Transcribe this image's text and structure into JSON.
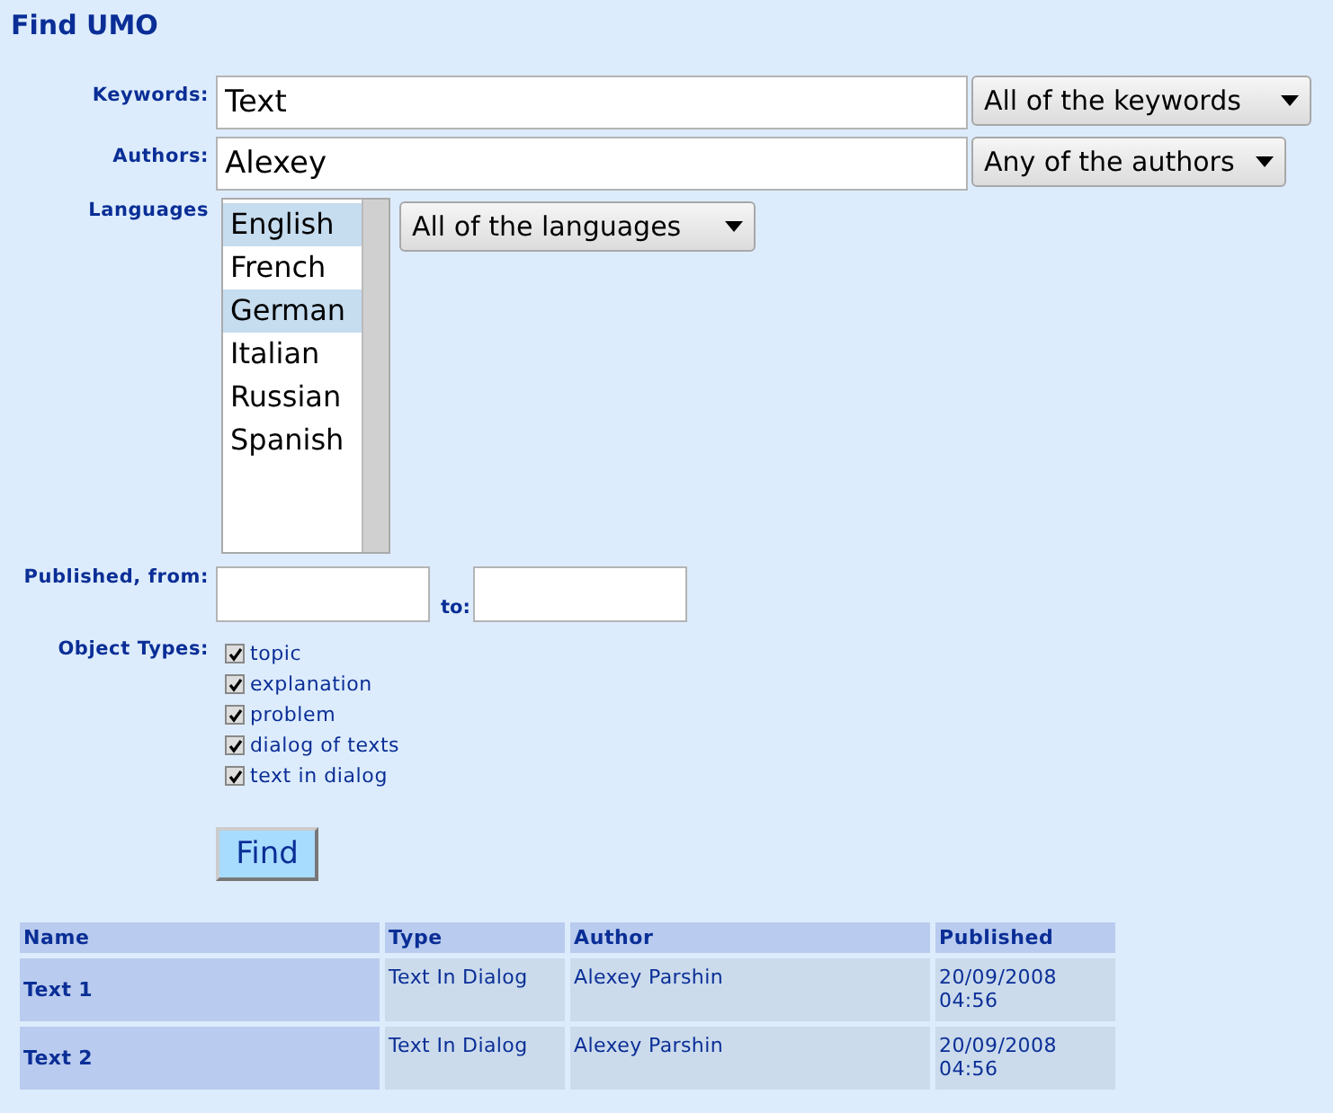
{
  "title": "Find UMO",
  "keywords": {
    "label": "Keywords:",
    "value": "Text",
    "mode": "All of the keywords"
  },
  "authors": {
    "label": "Authors:",
    "value": "Alexey",
    "mode": "Any of the authors"
  },
  "languages": {
    "label": "Languages",
    "mode": "All of the languages",
    "items": [
      {
        "label": "English",
        "selected": true
      },
      {
        "label": "French",
        "selected": false
      },
      {
        "label": "German",
        "selected": true
      },
      {
        "label": "Italian",
        "selected": false
      },
      {
        "label": "Russian",
        "selected": false
      },
      {
        "label": "Spanish",
        "selected": false
      }
    ]
  },
  "published": {
    "label": "Published, from:",
    "to_label": "to:"
  },
  "object_types": {
    "label": "Object Types:",
    "items": [
      {
        "label": "topic",
        "checked": true
      },
      {
        "label": "explanation",
        "checked": true
      },
      {
        "label": "problem",
        "checked": true
      },
      {
        "label": "dialog of texts",
        "checked": true
      },
      {
        "label": "text in dialog",
        "checked": true
      }
    ]
  },
  "find_button": "Find",
  "table": {
    "columns": [
      "Name",
      "Type",
      "Author",
      "Published"
    ],
    "rows": [
      [
        "Text 1",
        "Text In Dialog",
        "Alexey Parshin",
        "20/09/2008 04:56"
      ],
      [
        "Text 2",
        "Text In Dialog",
        "Alexey Parshin",
        "20/09/2008 04:56"
      ]
    ]
  }
}
